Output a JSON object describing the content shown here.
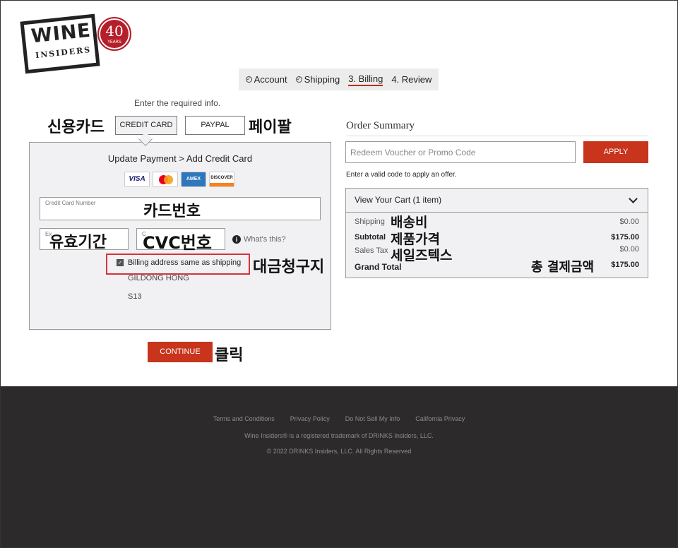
{
  "logo": {
    "brand": "WINE",
    "sub": "INSIDERS",
    "seal_number": "40",
    "seal_text": "YEARS",
    "reg": "®"
  },
  "steps": [
    {
      "label": "Account",
      "done": true
    },
    {
      "label": "Shipping",
      "done": true
    },
    {
      "label": "3. Billing",
      "active": true
    },
    {
      "label": "4. Review"
    }
  ],
  "required_info": "Enter the required info.",
  "payment": {
    "tab_credit_card": "CREDIT CARD",
    "tab_paypal": "PAYPAL",
    "panel_title": "Update Payment > Add Credit Card",
    "card_logos": [
      "VISA",
      "mastercard",
      "AMEX",
      "DISCOVER"
    ],
    "credit_card_number_label": "Credit Card Number",
    "expiry_label": "Ex",
    "cvc_label": "C",
    "whats_this": "What's this?",
    "billing_same_label": "Billing address same as shipping",
    "billing_checked": true,
    "address_name": "GILDONG HONG",
    "address_line": "S13",
    "continue_label": "CONTINUE"
  },
  "annotations": {
    "credit_card": "신용카드",
    "paypal": "페이팔",
    "card_number": "카드번호",
    "expiry": "유효기간",
    "cvc": "CVC번호",
    "billing": "대금청구지",
    "click": "클릭",
    "shipping": "배송비",
    "subtotal": "제품가격",
    "sales_tax": "세일즈텍스",
    "grand_total": "총 결제금액"
  },
  "order_summary": {
    "title": "Order Summary",
    "voucher_placeholder": "Redeem Voucher or Promo Code",
    "apply_label": "APPLY",
    "valid_code_note": "Enter a valid code to apply an offer.",
    "cart_header": "View Your Cart (1 item)",
    "rows": {
      "shipping_label": "Shipping",
      "shipping_value": "$0.00",
      "subtotal_label": "Subtotal",
      "subtotal_value": "$175.00",
      "tax_label": "Sales Tax",
      "tax_value": "$0.00",
      "total_label": "Grand Total",
      "total_value": "$175.00"
    }
  },
  "footer": {
    "links": [
      "Terms and Conditions",
      "Privacy Policy",
      "Do Not Sell My Info",
      "California Privacy"
    ],
    "trademark": "Wine Insiders® is a registered trademark of DRINKS Insiders, LLC.",
    "copyright": "© 2022 DRINKS Insiders, LLC. All Rights Reserved"
  },
  "colors": {
    "accent": "#c8341c",
    "annotation_box": "#d6323c",
    "footer_bg": "#2d2a2b",
    "panel_bg": "#f1f1f4"
  }
}
